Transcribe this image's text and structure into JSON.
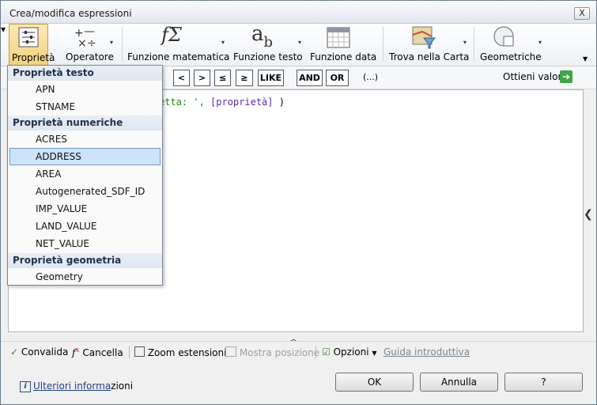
{
  "window": {
    "title": "Crea/modifica espressioni",
    "close_label": "X"
  },
  "ribbon": {
    "buttons": [
      {
        "label": "Proprietà",
        "icon": "properties-icon"
      },
      {
        "label": "Operatore",
        "icon": "operator-icon"
      },
      {
        "label": "Funzione matematica",
        "icon": "math-function-icon"
      },
      {
        "label": "Funzione testo",
        "icon": "text-function-icon"
      },
      {
        "label": "Funzione data",
        "icon": "date-function-icon"
      },
      {
        "label": "Trova nella Carta",
        "icon": "map-find-icon"
      },
      {
        "label": "Geometriche",
        "icon": "geometry-icon"
      }
    ],
    "arrow": "▾",
    "math_glyph": "fΣ",
    "text_glyph_a": "a",
    "text_glyph_b": "b"
  },
  "toolbar": {
    "operators": [
      "<",
      ">",
      "≤",
      "≥",
      "LIKE",
      "AND",
      "OR"
    ],
    "ellipsis": "(...)",
    "get_values": "Ottieni valori",
    "get_values_icon": "➔"
  },
  "editor": {
    "string_part": "etta: ',",
    "prop_part": "[proprietà]",
    "close_part": ")"
  },
  "dropdown": {
    "sections": [
      {
        "title": "Proprietà testo",
        "items": [
          "APN",
          "STNAME"
        ]
      },
      {
        "title": "Proprietà numeriche",
        "items": [
          "ACRES",
          "ADDRESS",
          "AREA",
          "Autogenerated_SDF_ID",
          "IMP_VALUE",
          "LAND_VALUE",
          "NET_VALUE"
        ]
      },
      {
        "title": "Proprietà geometria",
        "items": [
          "Geometry"
        ]
      }
    ],
    "selected": "ADDRESS"
  },
  "bottom": {
    "validate": "Convalida",
    "clear": "Cancella",
    "zoom": "Zoom estensioni",
    "show_position": "Mostra posizione",
    "options": "Opzioni",
    "guide": "Guida introduttiva"
  },
  "footer": {
    "more_info_link": "Ulteriori informa",
    "more_info_rest": "zioni",
    "ok": "OK",
    "cancel": "Annulla",
    "help": "?"
  },
  "colors": {
    "accent": "#f5d27a",
    "selection": "#cfe3f8",
    "string": "#1b8a1b",
    "property": "#5a2ea6"
  }
}
